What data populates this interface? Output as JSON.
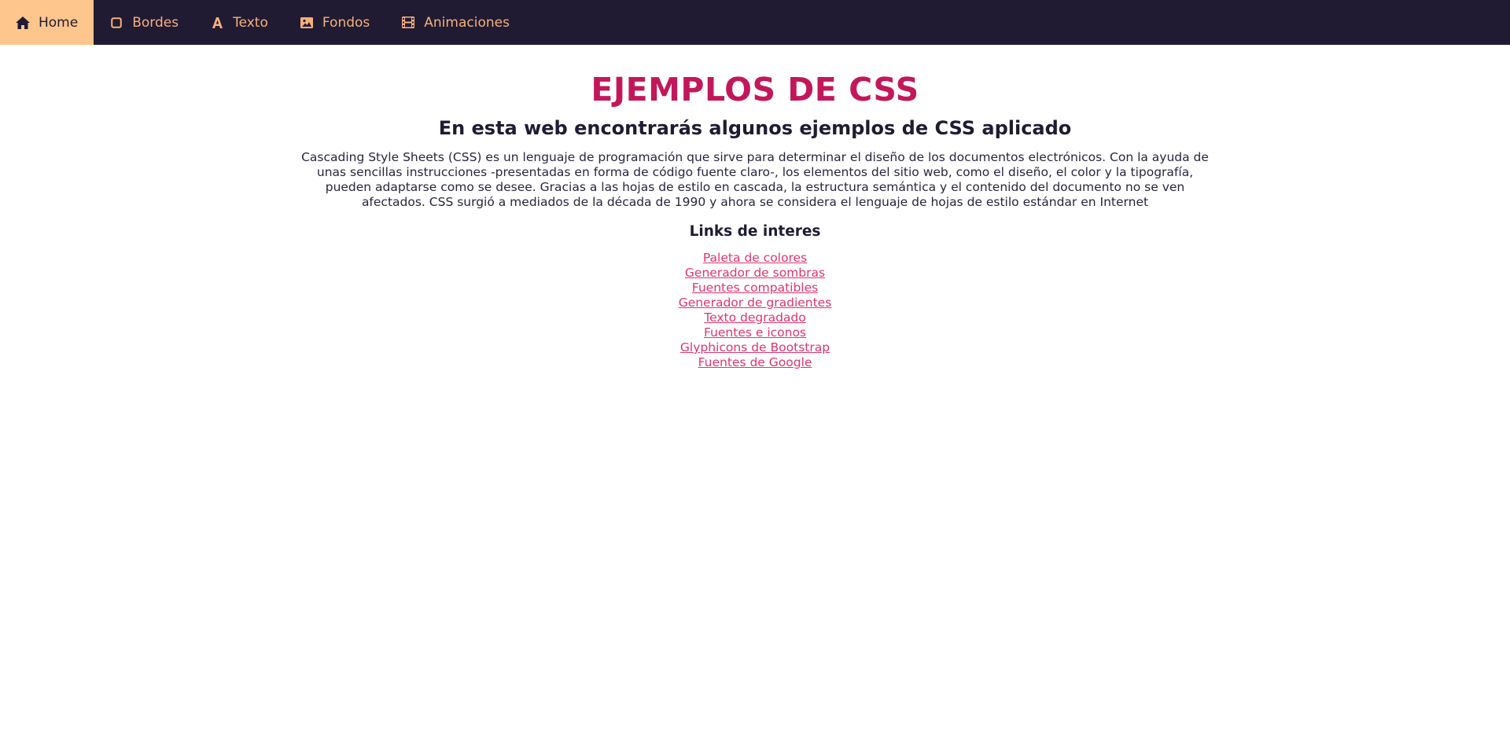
{
  "nav": {
    "items": [
      {
        "label": "Home",
        "icon": "home-icon",
        "active": true
      },
      {
        "label": "Bordes",
        "icon": "square-icon",
        "active": false
      },
      {
        "label": "Texto",
        "icon": "font-icon",
        "active": false
      },
      {
        "label": "Fondos",
        "icon": "image-icon",
        "active": false
      },
      {
        "label": "Animaciones",
        "icon": "film-icon",
        "active": false
      }
    ]
  },
  "main": {
    "title": "EJEMPLOS DE CSS",
    "subtitle": "En esta web encontrarás algunos ejemplos de CSS aplicado",
    "intro": "Cascading Style Sheets (CSS) es un lenguaje de programación que sirve para determinar el diseño de los documentos electrónicos. Con la ayuda de unas sencillas instrucciones -presentadas en forma de código fuente claro-, los elementos del sitio web, como el diseño, el color y la tipografía, pueden adaptarse como se desee. Gracias a las hojas de estilo en cascada, la estructura semántica y el contenido del documento no se ven afectados. CSS surgió a mediados de la década de 1990 y ahora se considera el lenguaje de hojas de estilo estándar en Internet",
    "links_title": "Links de interes",
    "links": [
      "Paleta de colores",
      "Generador de sombras",
      "Fuentes compatibles",
      "Generador de gradientes",
      "Texto degradado",
      "Fuentes e iconos",
      "Glyphicons de Bootstrap",
      "Fuentes de Google"
    ]
  },
  "colors": {
    "navbar_bg": "#201b33",
    "nav_text": "#f8b07a",
    "nav_active_bg": "#fec58d",
    "title": "#c2185b",
    "link": "#e0356f"
  }
}
